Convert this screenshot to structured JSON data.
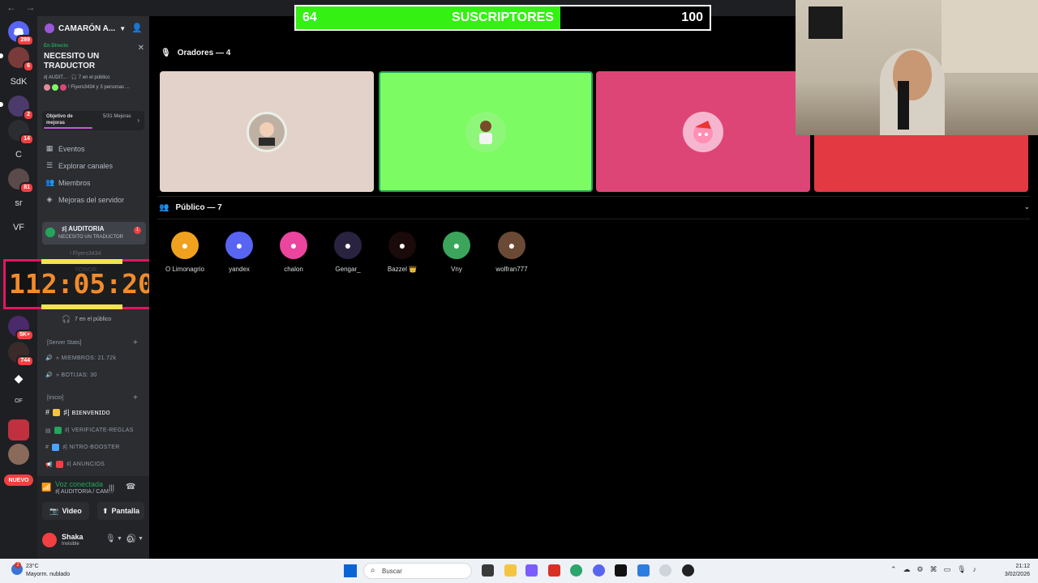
{
  "nav": {
    "back": "←",
    "forward": "→"
  },
  "rail": {
    "badges": [
      "289",
      "6",
      "2",
      "14",
      "81",
      "5K+",
      "744"
    ],
    "labels": [
      "SdK",
      "C",
      "sr",
      "VF",
      "OF"
    ],
    "nuevo": "NUEVO"
  },
  "server": {
    "name": "CAMARÓN A..."
  },
  "live": {
    "tag": "En Directo",
    "title": "NECESITO UN TRADUCTOR",
    "channel": "♯| AUDIT...",
    "audience": "7 en el público",
    "people": "! Flyers3434 y 3 personas ..."
  },
  "boost": {
    "label": "Objetivo de mejoras",
    "value": "5/31 Mejoras"
  },
  "menu": [
    "Eventos",
    "Explorar canales",
    "Miembros",
    "Mejoras del servidor"
  ],
  "voice_channel": {
    "name": "♯| AUDITORIA",
    "sub": "NECESITO UN TRADUCTOR",
    "badge": "1"
  },
  "members_under": {
    "m1": "! Flyers3434",
    "m2": "YOWOR",
    "audience": "7 en el público"
  },
  "timer": {
    "value": "112:05:20"
  },
  "categories": {
    "stats": "[Server Stats]",
    "inicio": "[Inicio]"
  },
  "stats_channels": [
    "» MIEMBROS: 21.72k",
    "» BOTIJAS: 30"
  ],
  "text_channels": [
    {
      "name": "♯| ʙɪᴇɴᴠᴇɴɪᴅᴏ",
      "emoji_color": "#f5c542"
    },
    {
      "name": "♯| VERIFICATE-REGLAS",
      "emoji_color": "#23a55a"
    },
    {
      "name": "♯| NITRO-BOOSTER",
      "emoji_color": "#4aa3ff"
    },
    {
      "name": "♯| ANUNCIOS",
      "emoji_color": "#f23f42"
    }
  ],
  "voice_status": {
    "state": "Voz conectada",
    "channel": "♯| AUDITORIA / CAM...",
    "video": "Video",
    "screen": "Pantalla"
  },
  "user": {
    "name": "Shaka",
    "status": "Invisible"
  },
  "stage": {
    "speakers_header": "Oradores — 4",
    "audience_header": "Público — 7",
    "speaker_tiles": [
      {
        "bg": "#e2d2c9",
        "avatar": "#c9b6a8"
      },
      {
        "bg": "#7dfb62",
        "avatar": "#8ef77a"
      },
      {
        "bg": "#de4577",
        "avatar": "#f9a0c0"
      },
      {
        "bg": "#e23943",
        "avatar": "#e23943"
      }
    ],
    "audience": [
      {
        "name": "O Limonagrio",
        "color": "#f0a21f"
      },
      {
        "name": "yandex",
        "color": "#5865f2"
      },
      {
        "name": "chalon",
        "color": "#eb459e"
      },
      {
        "name": "Gengar_",
        "color": "#2a2340"
      },
      {
        "name": "Bazzel 👑",
        "color": "#1a0a0a"
      },
      {
        "name": "Vny",
        "color": "#3ba55c"
      },
      {
        "name": "wolfran777",
        "color": "#6b4a35"
      }
    ]
  },
  "progress": {
    "current": "64",
    "label": "SUSCRIPTORES",
    "goal": "100",
    "fraction": 0.64
  },
  "taskbar": {
    "temp": "23°C",
    "weather": "Mayorm. nublado",
    "weather_badge": "2",
    "search": "Buscar",
    "time": "21:12",
    "date": "3/02/2026"
  },
  "colors": {
    "accent_green": "#23a55a",
    "badge_red": "#f23f42",
    "blurple": "#5865f2"
  }
}
